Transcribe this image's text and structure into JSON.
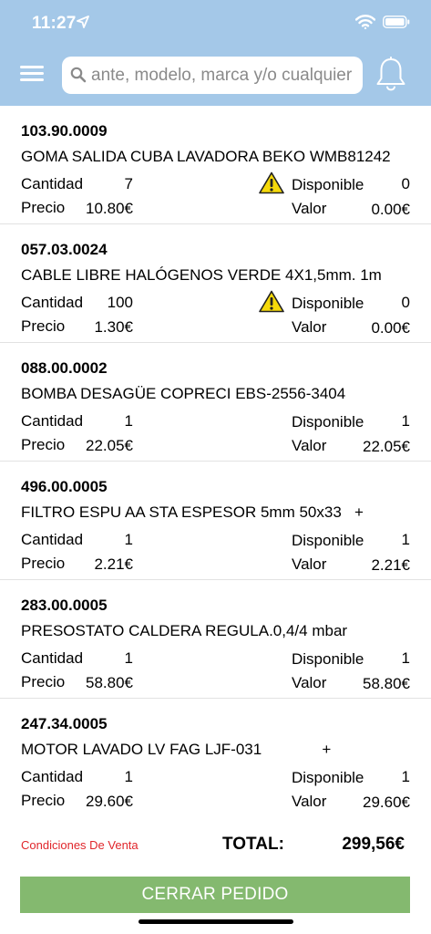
{
  "status": {
    "time": "11:27"
  },
  "search": {
    "placeholder": "ante, modelo, marca y/o cualquier"
  },
  "items": [
    {
      "code": "103.90.0009",
      "desc": "GOMA SALIDA CUBA LAVADORA BEKO WMB81242",
      "qty_label": "Cantidad",
      "qty": "7",
      "price_label": "Precio",
      "price": "10.80€",
      "avail_label": "Disponible",
      "avail": "0",
      "value_label": "Valor",
      "value": "0.00€",
      "warning": true
    },
    {
      "code": "057.03.0024",
      "desc": "CABLE LIBRE HALÓGENOS VERDE 4X1,5mm. 1m",
      "qty_label": "Cantidad",
      "qty": "100",
      "price_label": "Precio",
      "price": "1.30€",
      "avail_label": "Disponible",
      "avail": "0",
      "value_label": "Valor",
      "value": "0.00€",
      "warning": true
    },
    {
      "code": "088.00.0002",
      "desc": "BOMBA DESAGÜE COPRECI EBS-2556-3404",
      "qty_label": "Cantidad",
      "qty": "1",
      "price_label": "Precio",
      "price": "22.05€",
      "avail_label": "Disponible",
      "avail": "1",
      "value_label": "Valor",
      "value": "22.05€",
      "warning": false
    },
    {
      "code": "496.00.0005",
      "desc": "FILTRO ESPU AA STA ESPESOR 5mm 50x33   +",
      "qty_label": "Cantidad",
      "qty": "1",
      "price_label": "Precio",
      "price": "2.21€",
      "avail_label": "Disponible",
      "avail": "1",
      "value_label": "Valor",
      "value": "2.21€",
      "warning": false
    },
    {
      "code": "283.00.0005",
      "desc": "PRESOSTATO CALDERA REGULA.0,4/4 mbar",
      "qty_label": "Cantidad",
      "qty": "1",
      "price_label": "Precio",
      "price": "58.80€",
      "avail_label": "Disponible",
      "avail": "1",
      "value_label": "Valor",
      "value": "58.80€",
      "warning": false
    },
    {
      "code": "247.34.0005",
      "desc": "MOTOR LAVADO LV FAG LJF-031              +",
      "qty_label": "Cantidad",
      "qty": "1",
      "price_label": "Precio",
      "price": "29.60€",
      "avail_label": "Disponible",
      "avail": "1",
      "value_label": "Valor",
      "value": "29.60€",
      "warning": false
    }
  ],
  "footer": {
    "conditions": "Condiciones De Venta",
    "total_label": "TOTAL:",
    "total_value": "299,56€",
    "submit_label": "CERRAR PEDIDO"
  },
  "colors": {
    "header": "#a4c8e8",
    "submit": "#84b96f",
    "conditions": "#e0262b",
    "warning": "#f5d90a"
  },
  "icons": {
    "menu": "hamburger-icon",
    "search": "search-icon",
    "bell": "bell-icon",
    "warning": "warning-icon"
  }
}
